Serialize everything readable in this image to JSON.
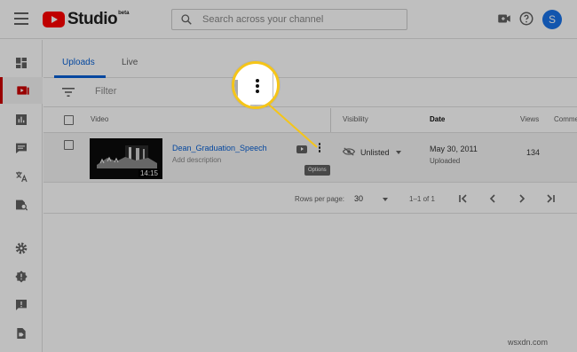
{
  "header": {
    "logo_text": "Studio",
    "logo_badge": "beta",
    "search_placeholder": "Search across your channel",
    "avatar_letter": "S"
  },
  "tabs": [
    {
      "label": "Uploads",
      "active": true
    },
    {
      "label": "Live",
      "active": false
    }
  ],
  "filter": {
    "placeholder": "Filter"
  },
  "table": {
    "columns": {
      "video": "Video",
      "visibility": "Visibility",
      "date": "Date",
      "views": "Views",
      "comments": "Comme"
    },
    "rows": [
      {
        "title": "Dean_Graduation_Speech",
        "description": "Add description",
        "duration": "14:15",
        "visibility": "Unlisted",
        "date": "May 30, 2011",
        "date_status": "Uploaded",
        "views": "134"
      }
    ],
    "options_tooltip": "Options"
  },
  "pagination": {
    "rows_per_page_label": "Rows per page:",
    "rows_per_page_value": "30",
    "range": "1–1 of 1"
  },
  "sidebar_icons": [
    "dashboard-icon",
    "videos-icon",
    "analytics-icon",
    "comments-icon",
    "translations-icon",
    "copyright-icon",
    "settings-icon",
    "feedback-alert-icon",
    "send-feedback-icon",
    "creator-studio-classic-icon"
  ],
  "header_icons": [
    "create-video-icon",
    "help-icon"
  ],
  "colors": {
    "accent_blue": "#065fd4",
    "brand_red": "#ff0000",
    "callout_yellow": "#f5c518",
    "avatar_blue": "#1a73e8"
  },
  "watermark": "wsxdn.com"
}
